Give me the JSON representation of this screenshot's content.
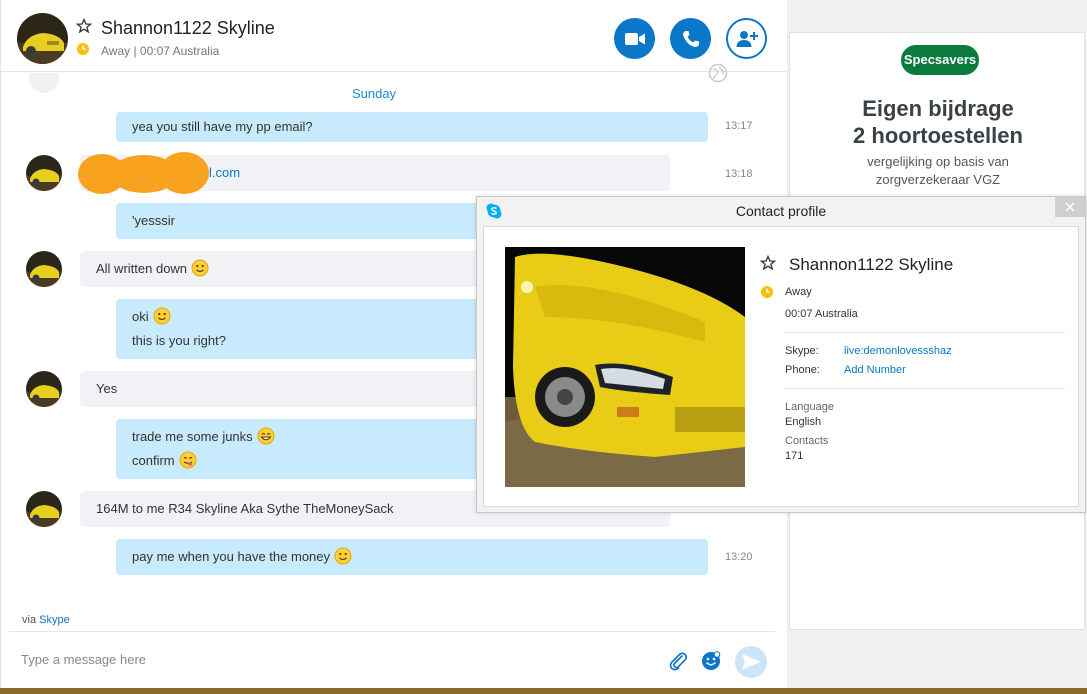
{
  "header": {
    "name": "Shannon1122 Skyline",
    "status": "Away",
    "location": "00:07 Australia",
    "status_line": "Away  |  00:07 Australia",
    "buttons": [
      "video-call",
      "audio-call",
      "add-people"
    ]
  },
  "chat": {
    "day_separator": "Sunday",
    "messages": [
      {
        "dir": "out",
        "lines": [
          "yea you still have my pp email?"
        ],
        "time": "13:17"
      },
      {
        "dir": "in",
        "lines": [
          "l.com"
        ],
        "time": "13:18",
        "redacted": true
      },
      {
        "dir": "out",
        "lines": [
          "'yesssir"
        ]
      },
      {
        "dir": "in",
        "lines": [
          "All written down"
        ],
        "emoji": "smile"
      },
      {
        "dir": "out",
        "lines": [
          "oki",
          "this is you right?"
        ]
      },
      {
        "dir": "in",
        "lines": [
          "Yes"
        ]
      },
      {
        "dir": "out",
        "lines": [
          "trade me some junks",
          "confirm"
        ]
      },
      {
        "dir": "in",
        "lines": [
          "164M to me R34 Skyline Aka Sythe TheMoneySack"
        ]
      },
      {
        "dir": "out",
        "lines": [
          "pay me when you have the money"
        ],
        "time": "13:20",
        "emoji": "smile"
      }
    ],
    "via_prefix": "via",
    "via_link": "Skype"
  },
  "compose": {
    "placeholder": "Type a message here"
  },
  "ad": {
    "brand": "Specsavers",
    "title_line1": "Eigen bijdrage",
    "title_line2": "2 hoortoestellen",
    "sub_line1": "vergelijking op basis van",
    "sub_line2": "zorgverzekeraar VGZ"
  },
  "profile": {
    "window_title": "Contact profile",
    "name": "Shannon1122 Skyline",
    "status": "Away",
    "location": "00:07 Australia",
    "skype_label": "Skype:",
    "skype_value": "live:demonlovessshaz",
    "phone_label": "Phone:",
    "phone_value": "Add Number",
    "language_label": "Language",
    "language_value": "English",
    "contacts_label": "Contacts",
    "contacts_value": "171"
  },
  "colors": {
    "accent": "#0a77c8",
    "outgoing_bubble": "#c7eafc",
    "incoming_bubble": "#f0f2f5",
    "away": "#f4c20d",
    "brand_green": "#0a7a3d"
  }
}
